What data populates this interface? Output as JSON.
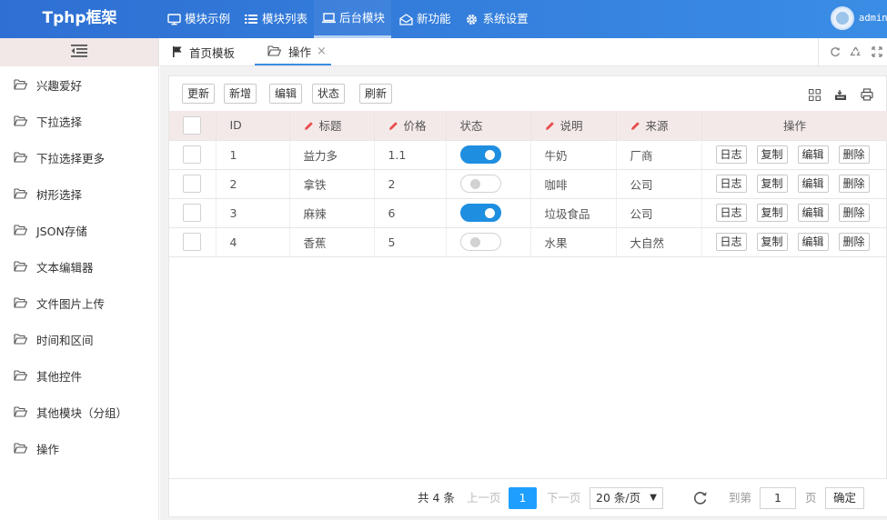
{
  "header": {
    "logo": "Tphp框架",
    "nav": [
      {
        "label": "模块示例",
        "icon": "monitor-icon"
      },
      {
        "label": "模块列表",
        "icon": "list-icon"
      },
      {
        "label": "后台模块",
        "icon": "laptop-icon",
        "active": true
      },
      {
        "label": "新功能",
        "icon": "mail-open-icon"
      },
      {
        "label": "系统设置",
        "icon": "gear-icon"
      }
    ],
    "user": "admin"
  },
  "sidebar": {
    "toggle_icon": "menu-collapse-icon",
    "items": [
      {
        "label": "兴趣爱好"
      },
      {
        "label": "下拉选择"
      },
      {
        "label": "下拉选择更多"
      },
      {
        "label": "树形选择"
      },
      {
        "label": "JSON存储"
      },
      {
        "label": "文本编辑器"
      },
      {
        "label": "文件图片上传"
      },
      {
        "label": "时间和区间"
      },
      {
        "label": "其他控件"
      },
      {
        "label": "其他模块（分组）"
      },
      {
        "label": "操作"
      }
    ]
  },
  "tabs": [
    {
      "label": "首页模板",
      "icon": "flag-icon"
    },
    {
      "label": "操作",
      "icon": "folder-open-icon",
      "active": true,
      "close": "×"
    }
  ],
  "toolbar": {
    "buttons": [
      "更新",
      "新增",
      "编辑",
      "状态",
      "刷新"
    ],
    "icons": [
      "columns-icon",
      "export-icon",
      "print-icon"
    ]
  },
  "table": {
    "headers": [
      "ID",
      "标题",
      "价格",
      "状态",
      "说明",
      "来源",
      "操作"
    ],
    "rows": [
      {
        "id": "1",
        "title": "益力多",
        "price": "1.1",
        "status": true,
        "desc": "牛奶",
        "source": "厂商"
      },
      {
        "id": "2",
        "title": "拿铁",
        "price": "2",
        "status": false,
        "desc": "咖啡",
        "source": "公司"
      },
      {
        "id": "3",
        "title": "麻辣",
        "price": "6",
        "status": true,
        "desc": "垃圾食品",
        "source": "公司"
      },
      {
        "id": "4",
        "title": "香蕉",
        "price": "5",
        "status": false,
        "desc": "水果",
        "source": "大自然"
      }
    ],
    "actions": [
      "日志",
      "复制",
      "编辑",
      "删除"
    ]
  },
  "pager": {
    "total": "共 4 条",
    "prev": "上一页",
    "current": "1",
    "next": "下一页",
    "page_size": "20 条/页",
    "goto_label": "到第",
    "goto_value": "1",
    "page_suffix": "页",
    "confirm": "确定"
  },
  "colors": {
    "header_start": "#2e6fd3",
    "header_end": "#3a8de4",
    "switch_on": "#1e8ee0",
    "pager_current": "#1e9fff",
    "table_header_bg": "#f4e9e9",
    "pen": "#e84c4c"
  }
}
